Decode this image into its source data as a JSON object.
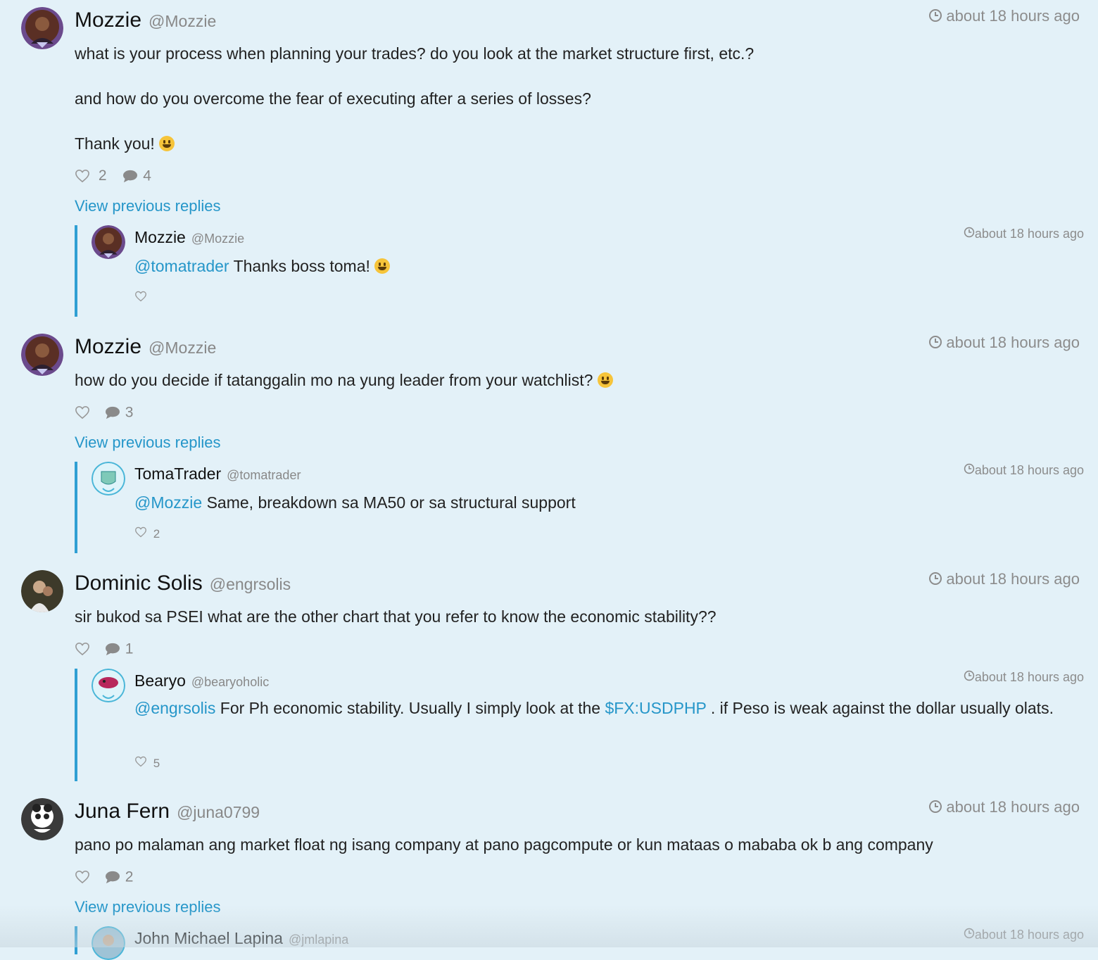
{
  "posts": [
    {
      "name": "Mozzie",
      "handle": "@Mozzie",
      "time": "about 18 hours ago",
      "lines": [
        "what is your process when planning your trades? do you look at the market structure first, etc.?",
        "and how do you overcome the fear of executing after a series of losses?",
        "Thank you!"
      ],
      "likes": "2",
      "comments": "4",
      "view_previous": "View previous replies",
      "reply": {
        "name": "Mozzie",
        "handle": "@Mozzie",
        "time": "about 18 hours ago",
        "mention": "@tomatrader",
        "text": "Thanks boss toma!",
        "likes": ""
      }
    },
    {
      "name": "Mozzie",
      "handle": "@Mozzie",
      "time": "about 18 hours ago",
      "text": "how do you decide if tatanggalin mo na yung leader from your watchlist?",
      "likes": "",
      "comments": "3",
      "view_previous": "View previous replies",
      "reply": {
        "name": "TomaTrader",
        "handle": "@tomatrader",
        "time": "about 18 hours ago",
        "mention": "@Mozzie",
        "text": "Same, breakdown sa MA50 or sa structural support",
        "likes": "2"
      }
    },
    {
      "name": "Dominic Solis",
      "handle": "@engrsolis",
      "time": "about 18 hours ago",
      "text": "sir bukod sa PSEI what are the other chart that you refer to know the economic stability??",
      "likes": "",
      "comments": "1",
      "reply": {
        "name": "Bearyo",
        "handle": "@bearyoholic",
        "time": "about 18 hours ago",
        "mention": "@engrsolis",
        "text_a": "For Ph economic stability. Usually I simply look at the",
        "ticker": "$FX:USDPHP",
        "text_b": ". if Peso is weak against the dollar usually olats.",
        "likes": "5"
      }
    },
    {
      "name": "Juna Fern",
      "handle": "@juna0799",
      "time": "about 18 hours ago",
      "text": "pano po malaman ang market float ng isang company at pano pagcompute or kun mataas o mababa ok b ang company",
      "likes": "",
      "comments": "2",
      "view_previous": "View previous replies",
      "reply": {
        "name": "John Michael Lapina",
        "handle": "@jmlapina",
        "time": "about 18 hours ago"
      }
    }
  ],
  "colors": {
    "background": "#e3f1f8",
    "link": "#2596c9",
    "reply_bar": "#2f9fd3",
    "muted": "#888888"
  },
  "icons": [
    "clock-icon",
    "heart-icon",
    "comment-icon",
    "smile-emoji"
  ]
}
